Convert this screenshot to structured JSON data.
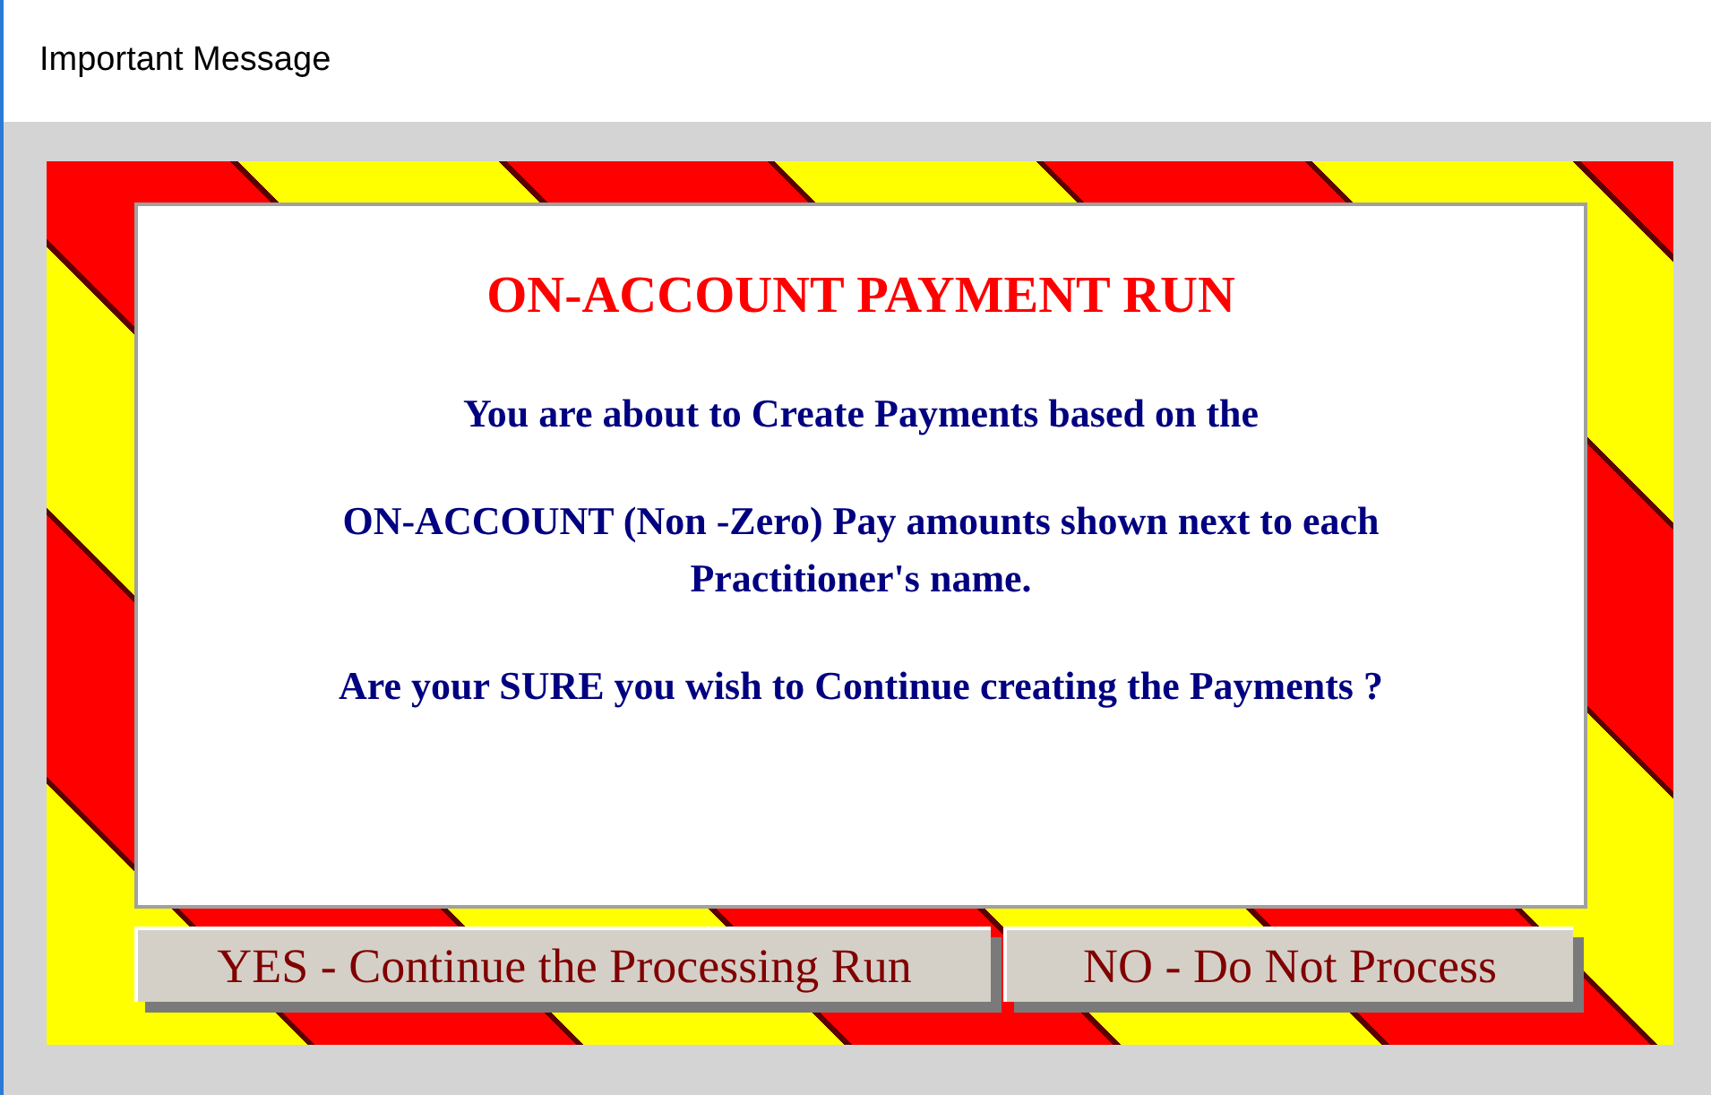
{
  "window": {
    "title": "Important Message"
  },
  "message": {
    "heading": "ON-ACCOUNT PAYMENT RUN",
    "paragraphs": [
      "You are about to Create Payments based on the",
      "ON-ACCOUNT (Non -Zero) Pay amounts shown next to each Practitioner's name.",
      "Are your SURE you wish to Continue creating the Payments ?"
    ]
  },
  "buttons": [
    "YES - Continue the Processing Run",
    "NO - Do Not Process"
  ]
}
